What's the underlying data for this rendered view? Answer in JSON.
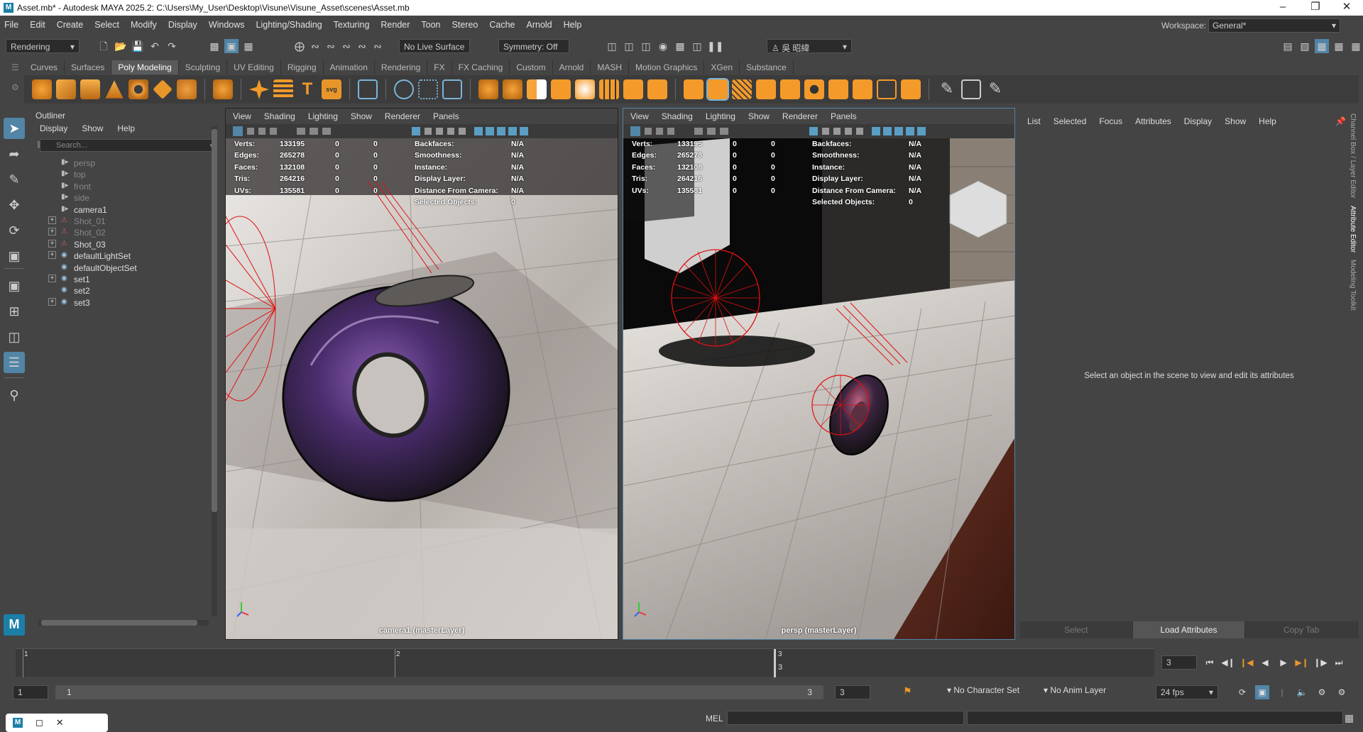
{
  "window": {
    "title": "Asset.mb* - Autodesk MAYA 2025.2: C:\\Users\\My_User\\Desktop\\Visune\\Visune_Asset\\scenes\\Asset.mb"
  },
  "menubar": {
    "items": [
      "File",
      "Edit",
      "Create",
      "Select",
      "Modify",
      "Display",
      "Windows",
      "Lighting/Shading",
      "Texturing",
      "Render",
      "Toon",
      "Stereo",
      "Cache",
      "Arnold",
      "Help"
    ],
    "workspace_label": "Workspace:",
    "workspace_value": "General*"
  },
  "statusline": {
    "menuset": "Rendering",
    "live_surface": "No Live Surface",
    "symmetry": "Symmetry: Off",
    "user": "吳 昭緯"
  },
  "shelf": {
    "tabs": [
      "Curves",
      "Surfaces",
      "Poly Modeling",
      "Sculpting",
      "UV Editing",
      "Rigging",
      "Animation",
      "Rendering",
      "FX",
      "FX Caching",
      "Custom",
      "Arnold",
      "MASH",
      "Motion Graphics",
      "XGen",
      "Substance"
    ],
    "active_tab": "Poly Modeling"
  },
  "outliner": {
    "title": "Outliner",
    "menu": [
      "Display",
      "Show",
      "Help"
    ],
    "search_placeholder": "Search...",
    "items": [
      {
        "label": "persp",
        "dim": true,
        "icon": "camera-icon",
        "expandable": false
      },
      {
        "label": "top",
        "dim": true,
        "icon": "camera-icon",
        "expandable": false
      },
      {
        "label": "front",
        "dim": true,
        "icon": "camera-icon",
        "expandable": false
      },
      {
        "label": "side",
        "dim": true,
        "icon": "camera-icon",
        "expandable": false
      },
      {
        "label": "camera1",
        "dim": false,
        "icon": "camera-icon",
        "expandable": false
      },
      {
        "label": "Shot_01",
        "dim": true,
        "icon": "shot-icon",
        "expandable": true
      },
      {
        "label": "Shot_02",
        "dim": true,
        "icon": "shot-icon",
        "expandable": true
      },
      {
        "label": "Shot_03",
        "dim": false,
        "icon": "shot-icon",
        "expandable": true
      },
      {
        "label": "defaultLightSet",
        "dim": false,
        "icon": "set-icon",
        "expandable": true
      },
      {
        "label": "defaultObjectSet",
        "dim": false,
        "icon": "set-icon",
        "expandable": false
      },
      {
        "label": "set1",
        "dim": false,
        "icon": "set-icon",
        "expandable": true
      },
      {
        "label": "set2",
        "dim": false,
        "icon": "set-icon",
        "expandable": false
      },
      {
        "label": "set3",
        "dim": false,
        "icon": "set-icon",
        "expandable": true
      }
    ]
  },
  "viewport_menu": [
    "View",
    "Shading",
    "Lighting",
    "Show",
    "Renderer",
    "Panels"
  ],
  "hud_left": [
    {
      "k": "Verts:",
      "a": "133195",
      "b": "0",
      "c": "0"
    },
    {
      "k": "Edges:",
      "a": "265278",
      "b": "0",
      "c": "0"
    },
    {
      "k": "Faces:",
      "a": "132108",
      "b": "0",
      "c": "0"
    },
    {
      "k": "Tris:",
      "a": "264216",
      "b": "0",
      "c": "0"
    },
    {
      "k": "UVs:",
      "a": "135581",
      "b": "0",
      "c": "0"
    }
  ],
  "hud_right": [
    {
      "k": "Backfaces:",
      "v": "N/A"
    },
    {
      "k": "Smoothness:",
      "v": "N/A"
    },
    {
      "k": "Instance:",
      "v": "N/A"
    },
    {
      "k": "Display Layer:",
      "v": "N/A"
    },
    {
      "k": "Distance From Camera:",
      "v": "N/A"
    },
    {
      "k": "Selected Objects:",
      "v": "0"
    }
  ],
  "viewport1": {
    "label": "camera1 (masterLayer)"
  },
  "viewport2": {
    "label": "persp (masterLayer)"
  },
  "attribute_editor": {
    "menu": [
      "List",
      "Selected",
      "Focus",
      "Attributes",
      "Display",
      "Show",
      "Help"
    ],
    "message": "Select an object in the scene to view and edit its attributes",
    "buttons": [
      "Select",
      "Load Attributes",
      "Copy Tab"
    ],
    "active_button": "Load Attributes"
  },
  "side_tabs": [
    "Channel Box / Layer Editor",
    "Attribute Editor",
    "Modeling Toolkit"
  ],
  "timeslider": {
    "ticks": [
      "1",
      "2",
      "3"
    ],
    "current_frame": "3",
    "frame_field": "3"
  },
  "rangebar": {
    "start": "1",
    "range_start": "1",
    "range_end": "3",
    "end": "3",
    "character_set": "No Character Set",
    "anim_layer": "No Anim Layer",
    "fps": "24 fps"
  },
  "cmdline": {
    "lang": "MEL"
  },
  "colors": {
    "accent": "#5285a6",
    "bg": "#444444",
    "panel": "#3a3a3a",
    "red_wire": "#e01010"
  }
}
